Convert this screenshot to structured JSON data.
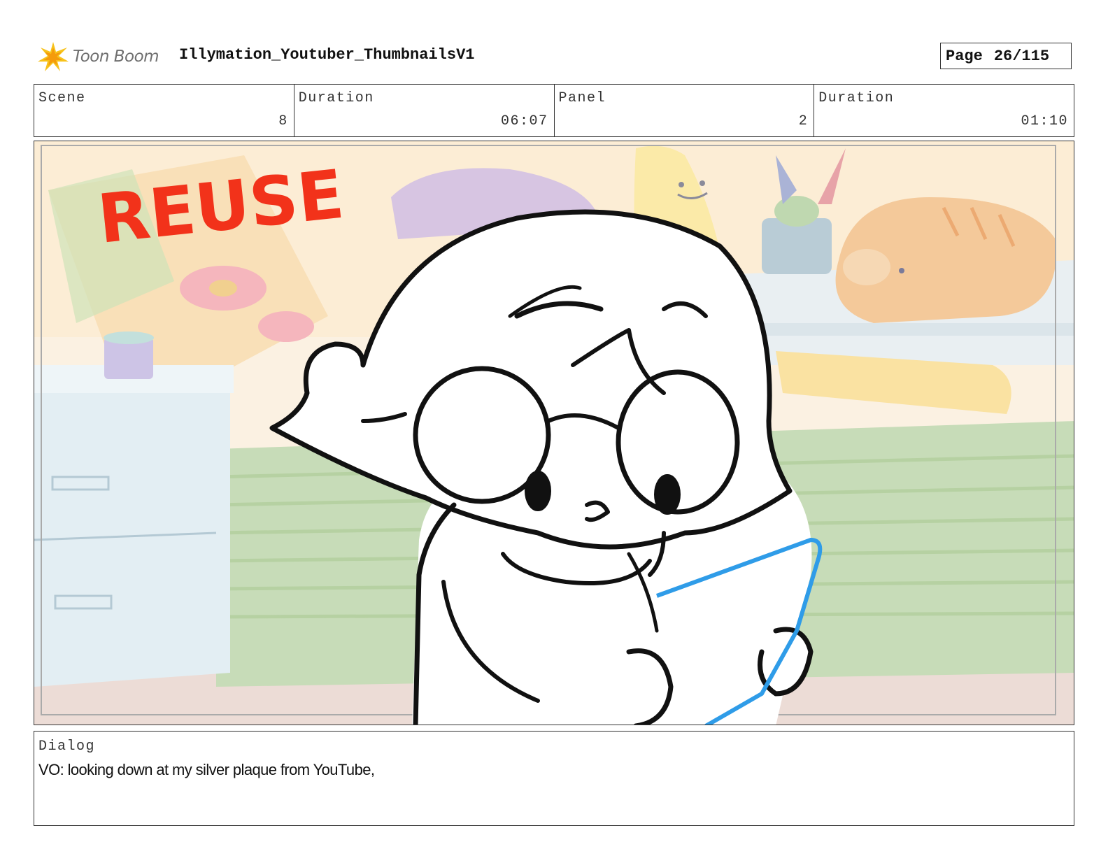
{
  "header": {
    "logo_text": "Toon Boom",
    "project_title": "Illymation_Youtuber_ThumbnailsV1",
    "page_label": "Page",
    "page_value": "26/115"
  },
  "info": {
    "scene_label": "Scene",
    "scene_value": "8",
    "scene_duration_label": "Duration",
    "scene_duration_value": "06:07",
    "panel_label": "Panel",
    "panel_value": "2",
    "panel_duration_label": "Duration",
    "panel_duration_value": "01:10"
  },
  "panel": {
    "stamp_text": "REUSE",
    "stamp_color": "#f2321a",
    "plaque_color": "#2f9ce8"
  },
  "dialog": {
    "label": "Dialog",
    "text": "VO: looking down at my silver plaque from YouTube,"
  }
}
